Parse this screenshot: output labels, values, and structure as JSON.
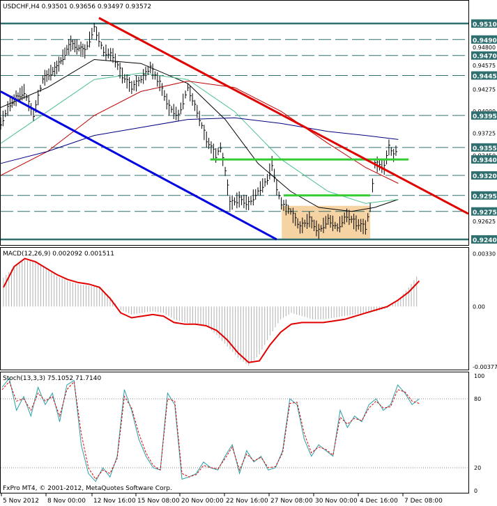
{
  "chart_data": [
    {
      "type": "candlestick",
      "title": "USDCHF,H4  0.93501 0.93656 0.93497 0.93572",
      "ylim": [
        0.9233,
        0.9522
      ],
      "y_ticks": [
        "0.95100",
        "0.94900",
        "0.94800",
        "0.94700",
        "0.94575",
        "0.94450",
        "0.94275",
        "0.94000",
        "0.93950",
        "0.93725",
        "0.93550",
        "0.93450",
        "0.93400",
        "0.93200",
        "0.92950",
        "0.92750",
        "0.92625",
        "0.92400"
      ],
      "highlighted_levels": [
        {
          "label": "0.95100",
          "value": 0.951,
          "color": "#ffffff"
        },
        {
          "label": "0.94900",
          "value": 0.949,
          "color": "#ffffff"
        },
        {
          "label": "0.94700",
          "value": 0.947,
          "color": "#ffffff"
        },
        {
          "label": "0.94450",
          "value": 0.9445,
          "color": "#ffffff"
        },
        {
          "label": "0.93950",
          "value": 0.9395,
          "color": "#ffffff"
        },
        {
          "label": "0.93550",
          "value": 0.9355,
          "color": "#ffffff"
        },
        {
          "label": "0.93400",
          "value": 0.934,
          "color": "#ffffff"
        },
        {
          "label": "0.93200",
          "value": 0.932,
          "color": "#ffffff"
        },
        {
          "label": "0.92950",
          "value": 0.9295,
          "color": "#ffffff"
        },
        {
          "label": "0.92750",
          "value": 0.9275,
          "color": "#ffffff"
        },
        {
          "label": "0.92400",
          "value": 0.924,
          "color": "#ffffff"
        }
      ],
      "dashed_levels": [
        0.949,
        0.947,
        0.9445,
        0.9395,
        0.9355,
        0.932,
        0.9295,
        0.9275
      ],
      "solid_levels": [
        0.951,
        0.924
      ],
      "green_lines": [
        {
          "x_from": 0.448,
          "x_to": 0.872,
          "y": 0.934
        },
        {
          "x_from": 0.605,
          "x_to": 0.79,
          "y": 0.9295
        }
      ],
      "range_box": {
        "x_from": 0.601,
        "x_to": 0.79,
        "y_from": 0.9282,
        "y_to": 0.9241,
        "color": "#f6d3a3"
      },
      "trendlines": [
        {
          "color": "#e00000",
          "x": [
            0.21,
            1.0
          ],
          "y": [
            0.9517,
            0.9272
          ]
        },
        {
          "color": "#0000e0",
          "x": [
            0.0,
            0.59
          ],
          "y": [
            0.9425,
            0.924
          ]
        }
      ],
      "close_path": [
        [
          0.0,
          0.9385
        ],
        [
          0.02,
          0.941
        ],
        [
          0.05,
          0.9425
        ],
        [
          0.07,
          0.9395
        ],
        [
          0.09,
          0.944
        ],
        [
          0.12,
          0.9455
        ],
        [
          0.15,
          0.9485
        ],
        [
          0.18,
          0.9475
        ],
        [
          0.2,
          0.9505
        ],
        [
          0.22,
          0.9475
        ],
        [
          0.24,
          0.947
        ],
        [
          0.26,
          0.9445
        ],
        [
          0.28,
          0.943
        ],
        [
          0.3,
          0.944
        ],
        [
          0.32,
          0.9455
        ],
        [
          0.34,
          0.9435
        ],
        [
          0.36,
          0.9405
        ],
        [
          0.38,
          0.9395
        ],
        [
          0.4,
          0.943
        ],
        [
          0.42,
          0.94
        ],
        [
          0.44,
          0.9365
        ],
        [
          0.46,
          0.9345
        ],
        [
          0.47,
          0.9355
        ],
        [
          0.48,
          0.9325
        ],
        [
          0.49,
          0.9285
        ],
        [
          0.51,
          0.929
        ],
        [
          0.53,
          0.9285
        ],
        [
          0.55,
          0.93
        ],
        [
          0.57,
          0.9315
        ],
        [
          0.58,
          0.9335
        ],
        [
          0.59,
          0.9305
        ],
        [
          0.6,
          0.9285
        ],
        [
          0.62,
          0.9275
        ],
        [
          0.64,
          0.9255
        ],
        [
          0.66,
          0.9265
        ],
        [
          0.68,
          0.925
        ],
        [
          0.7,
          0.9265
        ],
        [
          0.72,
          0.9255
        ],
        [
          0.74,
          0.927
        ],
        [
          0.76,
          0.926
        ],
        [
          0.78,
          0.9255
        ],
        [
          0.79,
          0.928
        ],
        [
          0.8,
          0.9335
        ],
        [
          0.82,
          0.933
        ],
        [
          0.83,
          0.9355
        ],
        [
          0.84,
          0.9345
        ],
        [
          0.85,
          0.9357
        ]
      ],
      "moving_averages": [
        {
          "color": "#000000",
          "points": [
            [
              0.0,
              0.9405
            ],
            [
              0.1,
              0.943
            ],
            [
              0.2,
              0.9465
            ],
            [
              0.3,
              0.946
            ],
            [
              0.4,
              0.9435
            ],
            [
              0.48,
              0.939
            ],
            [
              0.55,
              0.9335
            ],
            [
              0.62,
              0.93
            ],
            [
              0.68,
              0.928
            ],
            [
              0.75,
              0.9275
            ],
            [
              0.8,
              0.928
            ],
            [
              0.85,
              0.929
            ]
          ]
        },
        {
          "color": "#4cc08c",
          "points": [
            [
              0.0,
              0.936
            ],
            [
              0.1,
              0.94
            ],
            [
              0.2,
              0.944
            ],
            [
              0.3,
              0.9448
            ],
            [
              0.4,
              0.944
            ],
            [
              0.5,
              0.94
            ],
            [
              0.6,
              0.934
            ],
            [
              0.7,
              0.93
            ],
            [
              0.78,
              0.9285
            ],
            [
              0.85,
              0.929
            ]
          ]
        },
        {
          "color": "#c00000",
          "points": [
            [
              0.0,
              0.932
            ],
            [
              0.1,
              0.935
            ],
            [
              0.2,
              0.9395
            ],
            [
              0.3,
              0.9425
            ],
            [
              0.4,
              0.9438
            ],
            [
              0.5,
              0.943
            ],
            [
              0.6,
              0.94
            ],
            [
              0.7,
              0.936
            ],
            [
              0.78,
              0.933
            ],
            [
              0.85,
              0.931
            ]
          ]
        },
        {
          "color": "#000080",
          "points": [
            [
              0.0,
              0.9335
            ],
            [
              0.1,
              0.935
            ],
            [
              0.2,
              0.937
            ],
            [
              0.3,
              0.938
            ],
            [
              0.4,
              0.939
            ],
            [
              0.5,
              0.9392
            ],
            [
              0.6,
              0.9385
            ],
            [
              0.7,
              0.9375
            ],
            [
              0.78,
              0.937
            ],
            [
              0.85,
              0.9365
            ]
          ]
        }
      ]
    },
    {
      "type": "line+histogram",
      "title": "MACD(12,26,9) 0.002092 0.001511",
      "ylim": [
        -0.0039,
        0.0035
      ],
      "y_ticks": [
        "0.00330",
        "0.00",
        "-0.00377"
      ],
      "histogram_color": "#b0b0b0",
      "signal_color": "#e00000",
      "histogram": [
        0.0018,
        0.0025,
        0.0029,
        0.0028,
        0.0024,
        0.0019,
        0.0016,
        0.0014,
        0.0013,
        0.0012,
        0.0006,
        -0.0002,
        -0.0005,
        -0.0004,
        -0.0003,
        -0.0004,
        -0.0008,
        -0.001,
        -0.0011,
        -0.0012,
        -0.0018,
        -0.0025,
        -0.0032,
        -0.0037,
        -0.003,
        -0.0018,
        -0.0008,
        -0.0004,
        -0.0006,
        -0.0008,
        -0.0008,
        -0.0007,
        -0.0006,
        -0.0005,
        -0.0004,
        -0.0003,
        -0.0001,
        0.0004,
        0.0012,
        0.0021
      ],
      "signal": [
        0.0012,
        0.0025,
        0.003,
        0.0028,
        0.0024,
        0.002,
        0.0017,
        0.0015,
        0.0014,
        0.0012,
        0.0005,
        -0.0004,
        -0.0007,
        -0.0006,
        -0.0005,
        -0.0006,
        -0.001,
        -0.0011,
        -0.0011,
        -0.0012,
        -0.0015,
        -0.0021,
        -0.0029,
        -0.0035,
        -0.0034,
        -0.0024,
        -0.0016,
        -0.0011,
        -0.001,
        -0.001,
        -0.001,
        -0.0009,
        -0.0008,
        -0.0006,
        -0.0004,
        -0.0002,
        0.0,
        0.0004,
        0.0009,
        0.0016
      ]
    },
    {
      "type": "line",
      "title": "Stoch(13,3,3) 75.1052 71.7140",
      "ylim": [
        0,
        100
      ],
      "y_ticks": [
        "100",
        "80",
        "20",
        "0"
      ],
      "series_colors": {
        "main": "#2aa0a8",
        "signal": "#e00000"
      },
      "main": [
        90,
        98,
        70,
        82,
        65,
        90,
        75,
        85,
        60,
        92,
        96,
        40,
        15,
        8,
        20,
        12,
        30,
        88,
        70,
        45,
        30,
        20,
        18,
        85,
        75,
        10,
        12,
        15,
        25,
        20,
        18,
        30,
        40,
        15,
        35,
        25,
        30,
        18,
        20,
        35,
        80,
        75,
        45,
        30,
        40,
        35,
        30,
        70,
        55,
        65,
        60,
        75,
        80,
        70,
        75,
        92,
        85,
        75,
        80
      ],
      "signal": [
        88,
        95,
        78,
        80,
        70,
        85,
        78,
        82,
        65,
        88,
        95,
        50,
        20,
        10,
        18,
        15,
        28,
        82,
        72,
        50,
        33,
        22,
        18,
        80,
        78,
        15,
        12,
        14,
        22,
        20,
        19,
        28,
        38,
        18,
        32,
        26,
        29,
        20,
        21,
        33,
        76,
        77,
        50,
        33,
        38,
        36,
        31,
        64,
        58,
        63,
        61,
        72,
        78,
        72,
        73,
        88,
        86,
        78,
        76
      ]
    }
  ],
  "x_labels": [
    "5 Nov 2012",
    "8 Nov 00:00",
    "12 Nov 16:00",
    "15 Nov 08:00",
    "20 Nov 00:00",
    "22 Nov 16:00",
    "27 Nov 08:00",
    "30 Nov 00:00",
    "4 Dec 16:00",
    "7 Dec 08:00"
  ],
  "copyright": "FxPro MT4, © 2001-2012, MetaQuotes Software Corp."
}
